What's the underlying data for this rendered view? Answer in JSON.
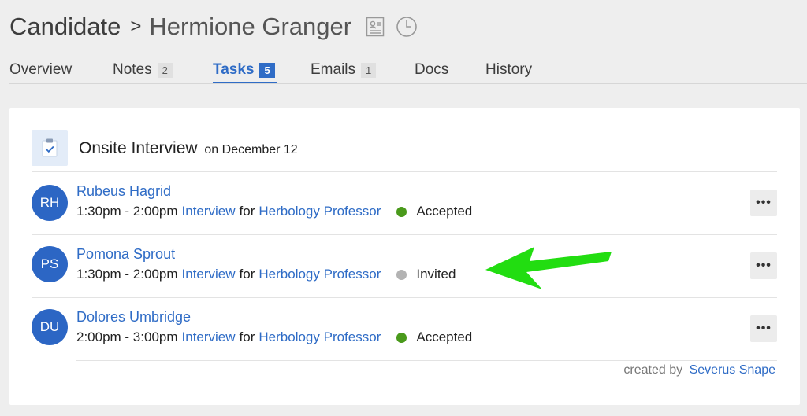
{
  "header": {
    "section": "Candidate",
    "separator": ">",
    "candidate_name": "Hermione Granger",
    "icons": [
      "profile-card-icon",
      "clock-icon"
    ]
  },
  "tabs": [
    {
      "label": "Overview",
      "count": ""
    },
    {
      "label": "Notes",
      "count": "2"
    },
    {
      "label": "Tasks",
      "count": "5",
      "active": true
    },
    {
      "label": "Emails",
      "count": "1"
    },
    {
      "label": "Docs",
      "count": ""
    },
    {
      "label": "History",
      "count": ""
    }
  ],
  "task": {
    "title": "Onsite Interview",
    "date_text": "on December 12",
    "icon": "clipboard-check-icon"
  },
  "interviews": [
    {
      "initials": "RH",
      "name": "Rubeus Hagrid",
      "time": "1:30pm - 2:00pm",
      "type": "Interview",
      "for_text": "for",
      "role": "Herbology Professor",
      "status": "Accepted",
      "status_color": "#4a9a1c"
    },
    {
      "initials": "PS",
      "name": "Pomona Sprout",
      "time": "1:30pm - 2:00pm",
      "type": "Interview",
      "for_text": "for",
      "role": "Herbology Professor",
      "status": "Invited",
      "status_color": "#b3b3b3"
    },
    {
      "initials": "DU",
      "name": "Dolores Umbridge",
      "time": "2:00pm - 3:00pm",
      "type": "Interview",
      "for_text": "for",
      "role": "Herbology Professor",
      "status": "Accepted",
      "status_color": "#4a9a1c"
    }
  ],
  "more_label": "•••",
  "footer": {
    "created_by_label": "created by",
    "creator": "Severus Snape"
  },
  "colors": {
    "accent": "#2f6cc6",
    "avatar": "#2c66c4",
    "arrow": "#22dd11"
  }
}
